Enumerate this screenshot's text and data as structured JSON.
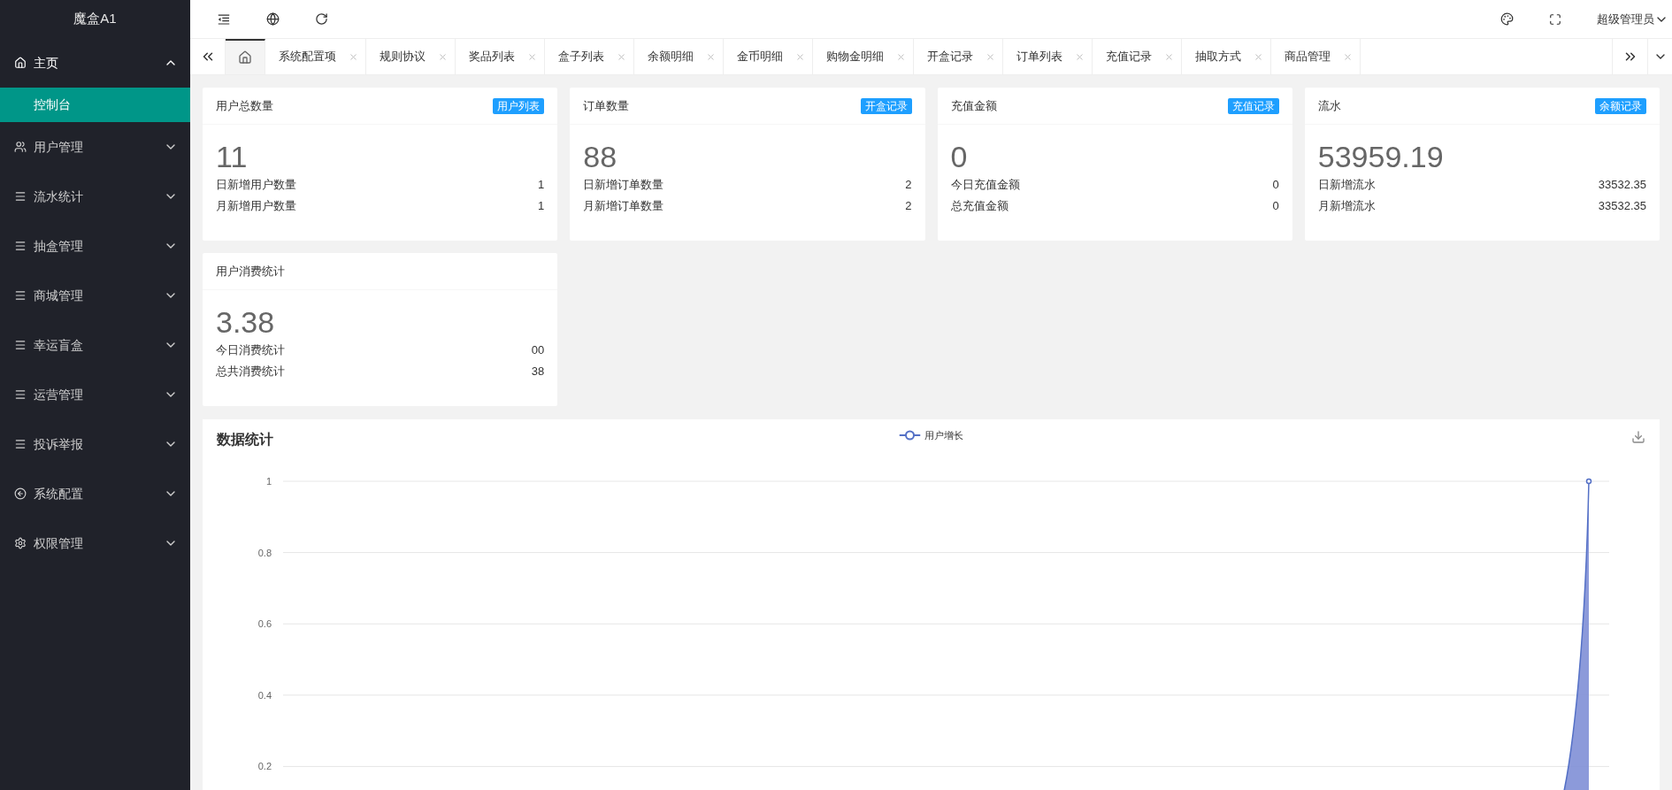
{
  "sidebar": {
    "title": "魔盒A1",
    "items": [
      {
        "label": "主页",
        "kind": "home",
        "expanded": true,
        "children": [
          {
            "label": "控制台",
            "selected": true
          }
        ]
      },
      {
        "label": "用户管理",
        "kind": "users",
        "expanded": false
      },
      {
        "label": "流水统计",
        "kind": "list",
        "expanded": false
      },
      {
        "label": "抽盒管理",
        "kind": "list",
        "expanded": false
      },
      {
        "label": "商城管理",
        "kind": "list",
        "expanded": false
      },
      {
        "label": "幸运盲盒",
        "kind": "list",
        "expanded": false
      },
      {
        "label": "运营管理",
        "kind": "list",
        "expanded": false
      },
      {
        "label": "投诉举报",
        "kind": "list",
        "expanded": false
      },
      {
        "label": "系统配置",
        "kind": "circle",
        "expanded": false
      },
      {
        "label": "权限管理",
        "kind": "gear",
        "expanded": false
      }
    ]
  },
  "header": {
    "user": "超级管理员"
  },
  "tabs": [
    {
      "kind": "home",
      "selected": true
    },
    {
      "kind": "page",
      "label": "系统配置项",
      "selected": false
    },
    {
      "kind": "page",
      "label": "规则协议",
      "selected": false
    },
    {
      "kind": "page",
      "label": "奖品列表",
      "selected": false
    },
    {
      "kind": "page",
      "label": "盒子列表",
      "selected": false
    },
    {
      "kind": "page",
      "label": "余额明细",
      "selected": false
    },
    {
      "kind": "page",
      "label": "金币明细",
      "selected": false
    },
    {
      "kind": "page",
      "label": "购物金明细",
      "selected": false
    },
    {
      "kind": "page",
      "label": "开盒记录",
      "selected": false
    },
    {
      "kind": "page",
      "label": "订单列表",
      "selected": false
    },
    {
      "kind": "page",
      "label": "充值记录",
      "selected": false
    },
    {
      "kind": "page",
      "label": "抽取方式",
      "selected": false
    },
    {
      "kind": "page",
      "label": "商品管理",
      "selected": false
    }
  ],
  "cards": [
    {
      "title": "用户总数量",
      "badge": "用户列表",
      "value": "11",
      "rows": [
        {
          "label": "日新增用户数量",
          "value": "1"
        },
        {
          "label": "月新增用户数量",
          "value": "1"
        }
      ]
    },
    {
      "title": "订单数量",
      "badge": "开盒记录",
      "value": "88",
      "rows": [
        {
          "label": "日新增订单数量",
          "value": "2"
        },
        {
          "label": "月新增订单数量",
          "value": "2"
        }
      ]
    },
    {
      "title": "充值金额",
      "badge": "充值记录",
      "value": "0",
      "rows": [
        {
          "label": "今日充值金额",
          "value": "0"
        },
        {
          "label": "总充值金额",
          "value": "0"
        }
      ]
    },
    {
      "title": "流水",
      "badge": "余额记录",
      "value": "53959.19",
      "rows": [
        {
          "label": "日新增流水",
          "value": "33532.35"
        },
        {
          "label": "月新增流水",
          "value": "33532.35"
        }
      ]
    },
    {
      "title": "用户消费统计",
      "value": "3.38",
      "rows": [
        {
          "label": "今日消费统计",
          "value": "00"
        },
        {
          "label": "总共消费统计",
          "value": "38"
        }
      ]
    }
  ],
  "chart": {
    "title": "数据统计",
    "chart_data": {
      "type": "area",
      "grid": true,
      "ylim": [
        0,
        1
      ],
      "yticks": [
        {
          "value": 0.2,
          "label": "0.2"
        },
        {
          "value": 0.4,
          "label": "0.4"
        },
        {
          "value": 0.6,
          "label": "0.6"
        },
        {
          "value": 0.8,
          "label": "0.8"
        },
        {
          "value": 1,
          "label": "1"
        }
      ],
      "series": [
        {
          "name": "用户增长",
          "color": "#5470c6",
          "values": [
            0,
            0,
            0,
            0,
            0,
            0,
            0,
            0,
            0,
            0,
            0,
            0,
            0,
            0,
            0,
            0,
            0,
            0,
            0,
            0,
            0,
            0,
            0,
            0,
            0,
            0,
            0,
            0,
            0,
            1
          ]
        }
      ]
    }
  }
}
